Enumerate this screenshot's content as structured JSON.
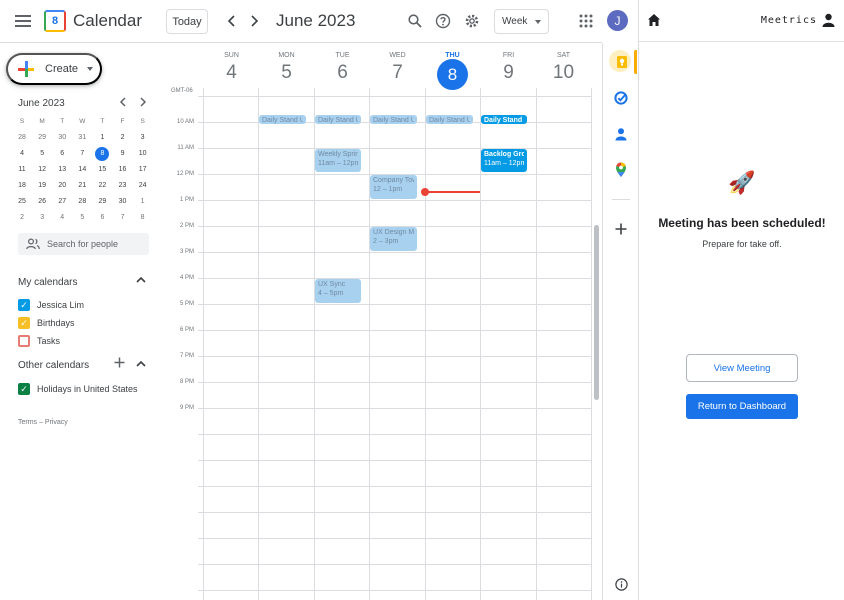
{
  "header": {
    "app_title": "Calendar",
    "logo_day": "8",
    "today_label": "Today",
    "prev_label": "‹",
    "next_label": "›",
    "month_title": "June 2023",
    "view_label": "Week",
    "avatar_initial": "J",
    "icons": [
      "menu-icon",
      "search-icon",
      "help-icon",
      "settings-icon",
      "apps-grid-icon"
    ]
  },
  "sidebar": {
    "create_label": "Create",
    "mini_calendar": {
      "title": "June 2023",
      "dow": [
        "S",
        "M",
        "T",
        "W",
        "T",
        "F",
        "S"
      ],
      "weeks": [
        [
          "28",
          "29",
          "30",
          "31",
          "1",
          "2",
          "3"
        ],
        [
          "4",
          "5",
          "6",
          "7",
          "8",
          "9",
          "10"
        ],
        [
          "11",
          "12",
          "13",
          "14",
          "15",
          "16",
          "17"
        ],
        [
          "18",
          "19",
          "20",
          "21",
          "22",
          "23",
          "24"
        ],
        [
          "25",
          "26",
          "27",
          "28",
          "29",
          "30",
          "1"
        ],
        [
          "2",
          "3",
          "4",
          "5",
          "6",
          "7",
          "8"
        ]
      ],
      "selected": "8"
    },
    "people_search_placeholder": "Search for people",
    "my_calendars_title": "My calendars",
    "my_calendars": [
      {
        "label": "Jessica Lim",
        "checked": true,
        "color": "#039be5"
      },
      {
        "label": "Birthdays",
        "checked": true,
        "color": "#f6bf26"
      },
      {
        "label": "Tasks",
        "checked": false,
        "color": "#e67c73"
      }
    ],
    "other_calendars_title": "Other calendars",
    "other_calendars": [
      {
        "label": "Holidays in United States",
        "checked": true,
        "color": "#0b8043"
      }
    ],
    "footer": "Terms – Privacy"
  },
  "week": {
    "timezone": "GMT-06",
    "days": [
      {
        "dow": "SUN",
        "num": "4"
      },
      {
        "dow": "MON",
        "num": "5"
      },
      {
        "dow": "TUE",
        "num": "6"
      },
      {
        "dow": "WED",
        "num": "7"
      },
      {
        "dow": "THU",
        "num": "8",
        "today": true
      },
      {
        "dow": "FRI",
        "num": "9"
      },
      {
        "dow": "SAT",
        "num": "10"
      }
    ],
    "hours": [
      "10 AM",
      "11 AM",
      "12 PM",
      "1 PM",
      "2 PM",
      "3 PM",
      "4 PM",
      "5 PM",
      "6 PM",
      "7 PM",
      "8 PM",
      "9 PM"
    ],
    "events": {
      "standup_mon": "Daily Stand Up",
      "standup_tue": "Daily Stand Up",
      "standup_wed": "Daily Stand Up",
      "standup_thu": "Daily Stand Up",
      "standup_fri": "Daily Stand Up",
      "weekly_sprint_title": "Weekly Sprint",
      "weekly_sprint_time": "11am – 12pm",
      "company_town_title": "Company Town Hall",
      "company_town_time": "12 – 1pm",
      "ux_design_title": "UX Design Meeting",
      "ux_design_time": "2 – 3pm",
      "ux_sync_title": "UX Sync",
      "ux_sync_time": "4 – 5pm",
      "backlog_title": "Backlog Grooming",
      "backlog_time": "11am – 12pm"
    }
  },
  "side_icons": [
    "keep-icon",
    "tasks-icon",
    "contacts-icon",
    "maps-icon",
    "add-icon",
    "info-icon"
  ],
  "meetrics": {
    "brand": "Meetrics",
    "emoji": "🚀",
    "title": "Meeting has been scheduled!",
    "subtitle": "Prepare for take off.",
    "view_button": "View Meeting",
    "dashboard_button": "Return to Dashboard"
  },
  "colors": {
    "accent": "#1a73e8",
    "event_light": "#a8d1f0",
    "event_solid": "#039be5",
    "now_line": "#ea4335"
  }
}
